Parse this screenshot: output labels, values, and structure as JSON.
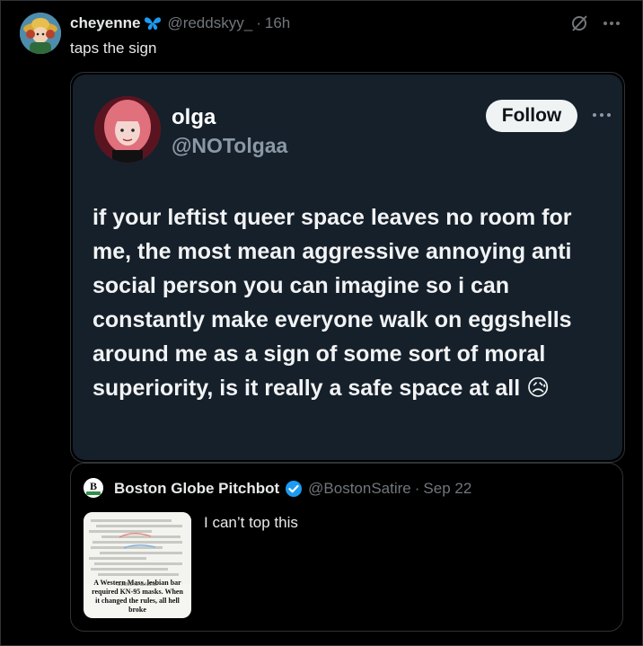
{
  "tweet": {
    "author_name": "cheyenne",
    "author_handle": "@reddskyy_",
    "separator": "·",
    "time": "16h",
    "text": "taps the sign"
  },
  "embedded_image": {
    "name": "olga",
    "handle": "@NOTolgaa",
    "follow_label": "Follow",
    "text": "if your leftist queer space leaves no room for me, the most mean aggressive annoying anti social person you can imagine so i can constantly make everyone walk on eggshells around me as a sign of some sort of moral superiority, is it really a safe space at all 😥"
  },
  "quoted_tweet": {
    "author_name": "Boston Globe Pitchbot",
    "author_handle": "@BostonSatire",
    "separator": "·",
    "time": "Sep 22",
    "text": "I can’t top this",
    "thumbnail_tag": "GLOBE MAGAZINE",
    "thumbnail_caption": "A Western Mass. lesbian bar required KN-95 masks. When it changed the rules, all hell broke"
  },
  "colors": {
    "background": "#000000",
    "muted": "#71767b",
    "text": "#e7e9ea",
    "verified_blue": "#1d9bf0",
    "embed_bg": "#15202b"
  }
}
